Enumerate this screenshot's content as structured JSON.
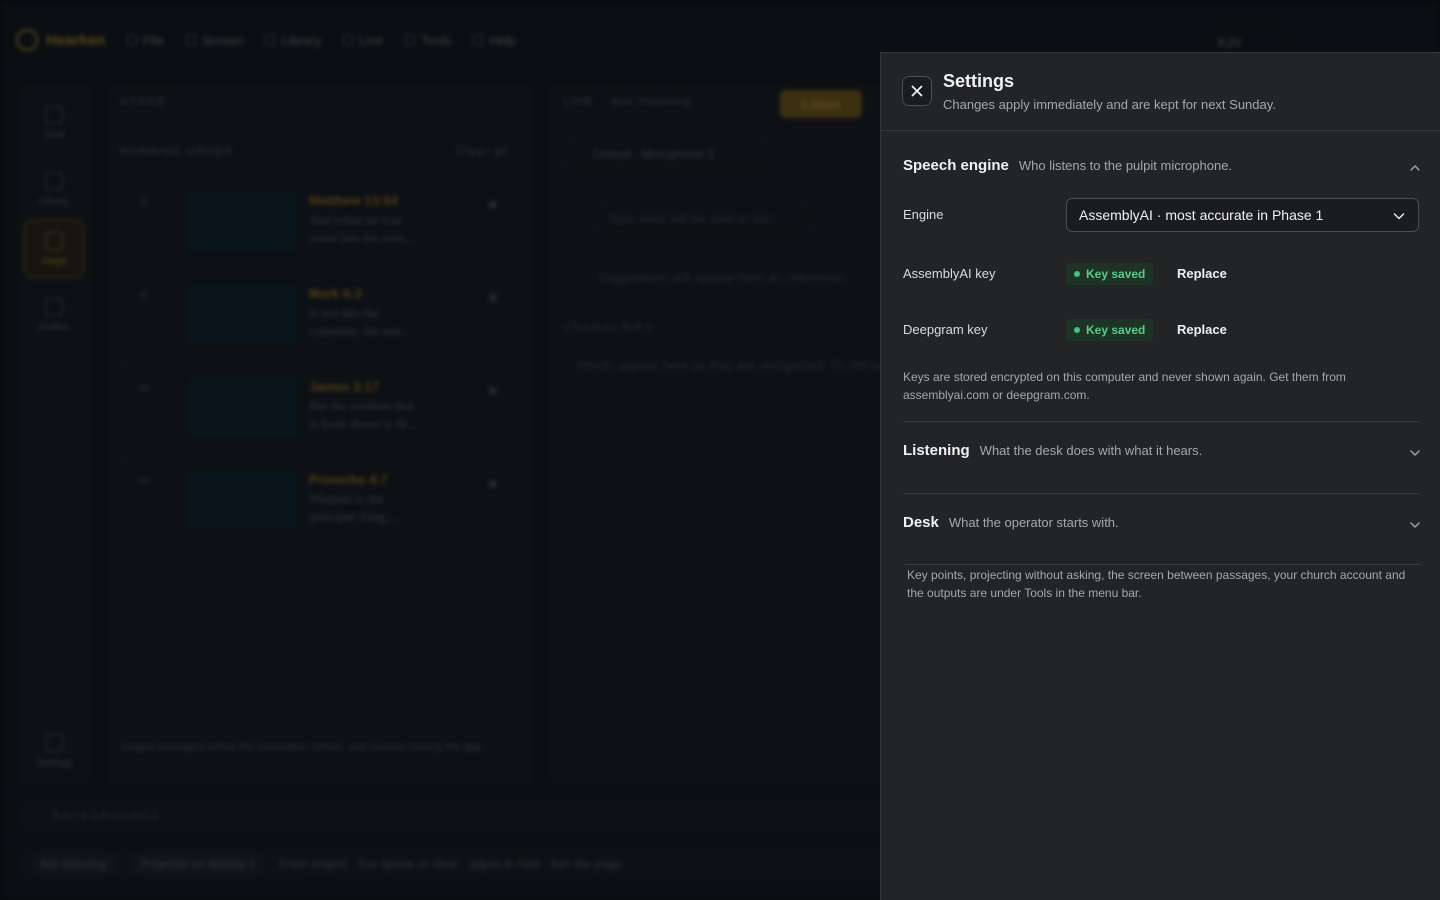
{
  "app": {
    "brand": "Hearken",
    "menu": [
      "File",
      "Screen",
      "Library",
      "Live",
      "Tools",
      "Help"
    ],
    "translation": "KJV",
    "rail": [
      "Find",
      "Library",
      "Stage",
      "Outline",
      "Settings"
    ],
    "stage": {
      "heading": "STAGE",
      "order_heading": "RUNNING ORDER",
      "clear_all": "Clear all",
      "items": [
        {
          "num": "#1",
          "ref": "Matthew 13:54",
          "text": "And when he was come into his own..."
        },
        {
          "num": "#2",
          "ref": "Mark 6:3",
          "text": "Is not this the carpenter, the son..."
        },
        {
          "num": "#3",
          "ref": "James 3:17",
          "text": "But the wisdom that is from above is fir..."
        },
        {
          "num": "#4",
          "ref": "Proverbs 4:7",
          "text": "Wisdom is the principal thing;..."
        }
      ],
      "footer": "Staged passages follow the translation switch, and survive closing the app."
    },
    "live": {
      "heading": "LIVE",
      "state": "Not listening",
      "listen_button": "Listen",
      "mic": "Default - Microphone 5",
      "say_placeholder": "Type what will be said or sun",
      "suggestions": "Suggestions will appear here as references",
      "transcript_heading": "TRANSCRIPT",
      "transcript_placeholder": "Words appear here as they are recognized. Th still being heard shows in grey."
    },
    "backgrounds": "BACKGROUNDS",
    "status": {
      "listening": "Not listening",
      "projector": "Projector on display 2",
      "hints": "Enter project · Esc ignore or clear · adjust in Find · turn the page"
    }
  },
  "settings": {
    "title": "Settings",
    "subtitle": "Changes apply immediately and are kept for next Sunday.",
    "speech": {
      "title": "Speech engine",
      "desc": "Who listens to the pulpit microphone.",
      "engine_label": "Engine",
      "engine_value": "AssemblyAI · most accurate in Phase 1",
      "assembly_label": "AssemblyAI key",
      "deepgram_label": "Deepgram key",
      "key_status": "Key saved",
      "replace": "Replace",
      "note": "Keys are stored encrypted on this computer and never shown again. Get them from assemblyai.com or deepgram.com."
    },
    "listening": {
      "title": "Listening",
      "desc": "What the desk does with what it hears."
    },
    "desk": {
      "title": "Desk",
      "desc": "What the operator starts with."
    },
    "footer_note": "Key points, projecting without asking, the screen between passages, your church account and the outputs are under Tools in the menu bar."
  },
  "colors": {
    "drawer_bg": "#232426",
    "accent_gold": "#c9a13a",
    "key_saved_green": "#5cc98a"
  }
}
